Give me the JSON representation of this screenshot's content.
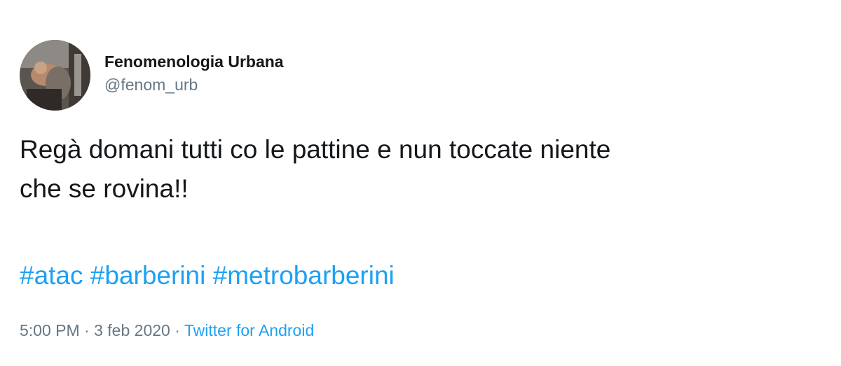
{
  "author": {
    "display_name": "Fenomenologia Urbana",
    "handle": "@fenom_urb"
  },
  "tweet": {
    "text_lines": [
      "Regà domani tutti co le pattine e nun toccate niente",
      "che se rovina!!"
    ],
    "hashtags": [
      "#atac",
      "#barberini",
      "#metrobarberini"
    ]
  },
  "meta": {
    "time": "5:00 PM",
    "separator": "·",
    "date": "3 feb 2020",
    "source": "Twitter for Android"
  },
  "colors": {
    "text_primary": "#14171a",
    "text_secondary": "#657786",
    "link": "#1da1f2"
  }
}
